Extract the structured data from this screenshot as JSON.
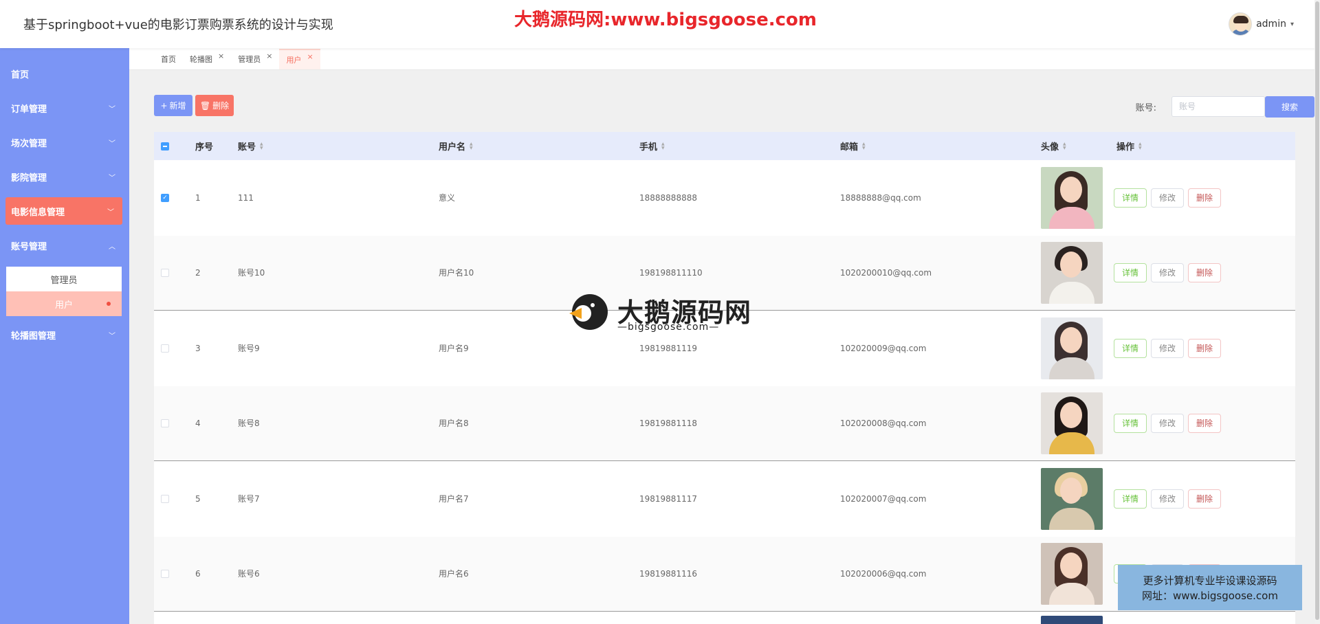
{
  "header": {
    "title": "基于springboot+vue的电影订票购票系统的设计与实现",
    "watermark": "大鹅源码网:www.bigsgoose.com",
    "user": "admin"
  },
  "sidebar": {
    "items": [
      {
        "label": "首页"
      },
      {
        "label": "订单管理"
      },
      {
        "label": "场次管理"
      },
      {
        "label": "影院管理"
      },
      {
        "label": "电影信息管理"
      },
      {
        "label": "账号管理"
      },
      {
        "label": "轮播图管理"
      }
    ],
    "sub": [
      {
        "label": "管理员"
      },
      {
        "label": "用户"
      }
    ]
  },
  "tabs": [
    {
      "label": "首页"
    },
    {
      "label": "轮播图"
    },
    {
      "label": "管理员"
    },
    {
      "label": "用户"
    }
  ],
  "toolbar": {
    "add_label": "新增",
    "delete_label": "删除",
    "search_label": "账号:",
    "search_placeholder": "账号",
    "search_button": "搜索"
  },
  "table": {
    "columns": [
      "序号",
      "账号",
      "用户名",
      "手机",
      "邮箱",
      "头像",
      "操作"
    ],
    "rows": [
      {
        "no": "1",
        "account": "111",
        "username": "意义",
        "phone": "18888888888",
        "email": "18888888@qq.com"
      },
      {
        "no": "2",
        "account": "账号10",
        "username": "用户名10",
        "phone": "198198811110",
        "email": "1020200010@qq.com"
      },
      {
        "no": "3",
        "account": "账号9",
        "username": "用户名9",
        "phone": "19819881119",
        "email": "102020009@qq.com"
      },
      {
        "no": "4",
        "account": "账号8",
        "username": "用户名8",
        "phone": "19819881118",
        "email": "102020008@qq.com"
      },
      {
        "no": "5",
        "account": "账号7",
        "username": "用户名7",
        "phone": "19819881117",
        "email": "102020007@qq.com"
      },
      {
        "no": "6",
        "account": "账号6",
        "username": "用户名6",
        "phone": "19819881116",
        "email": "102020006@qq.com"
      }
    ],
    "actions": {
      "detail": "详情",
      "edit": "修改",
      "remove": "删除"
    }
  },
  "watermarks": {
    "logo_text": "大鹅源码网",
    "logo_sub": "—bigsgoose.com—",
    "promo_line1": "更多计算机专业毕设课设源码",
    "promo_line2": "网址：www.bigsgoose.com"
  },
  "colors": {
    "sidebar": "#7b95f5",
    "accent": "#f87466",
    "primary": "#7b95f5"
  }
}
